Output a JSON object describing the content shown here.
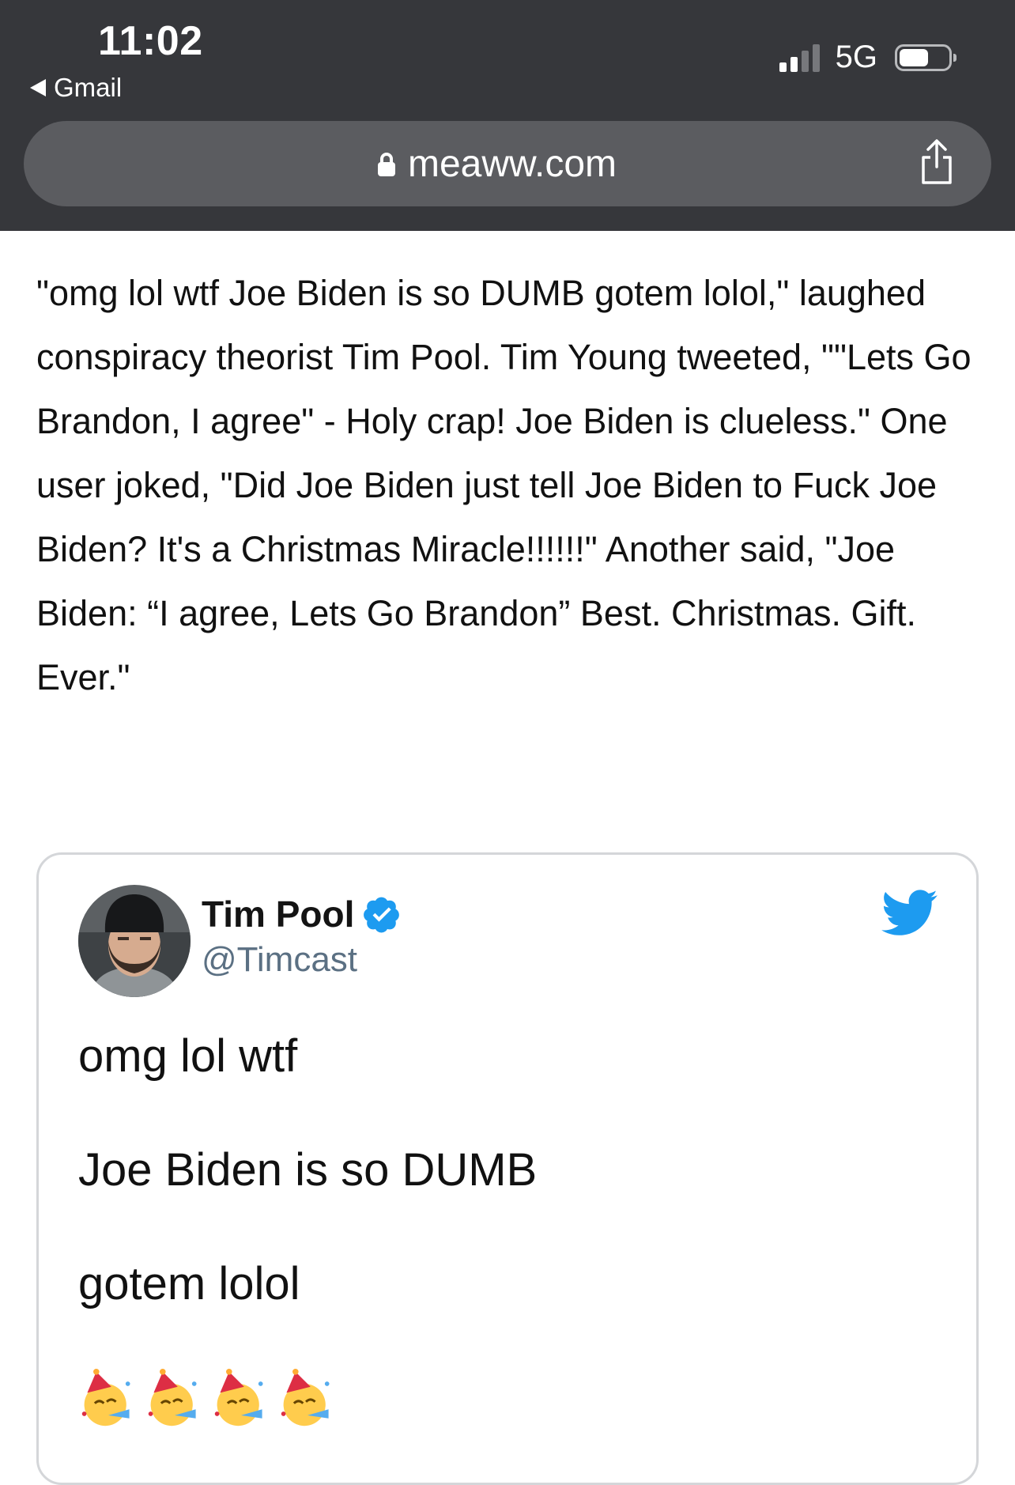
{
  "status_bar": {
    "time": "11:02",
    "back_app": "Gmail",
    "network": "5G"
  },
  "browser": {
    "url": "meaww.com"
  },
  "article": {
    "paragraph": "\"omg lol wtf Joe Biden is so DUMB gotem lolol,\" laughed conspiracy theorist Tim Pool. Tim Young tweeted, \"\"Lets Go Brandon, I agree\" - Holy crap! Joe Biden is clueless.\" One user joked, \"Did Joe Biden just tell Joe Biden to Fuck Joe Biden? It's a Christmas Miracle!!!!!!\" Another said, \"Joe Biden: “I agree, Lets Go Brandon” Best. Christmas. Gift. Ever.\""
  },
  "tweet": {
    "author_name": "Tim Pool",
    "handle": "@Timcast",
    "lines": [
      "omg lol wtf",
      "Joe Biden is so DUMB",
      "gotem lolol"
    ],
    "emoji_icons": [
      "partying-face-icon",
      "partying-face-icon",
      "partying-face-icon",
      "partying-face-icon"
    ]
  },
  "colors": {
    "chrome_bg": "#36373b",
    "urlbar_bg": "#5b5c60",
    "twitter_blue": "#1d9bf0",
    "handle_gray": "#5b7083"
  }
}
